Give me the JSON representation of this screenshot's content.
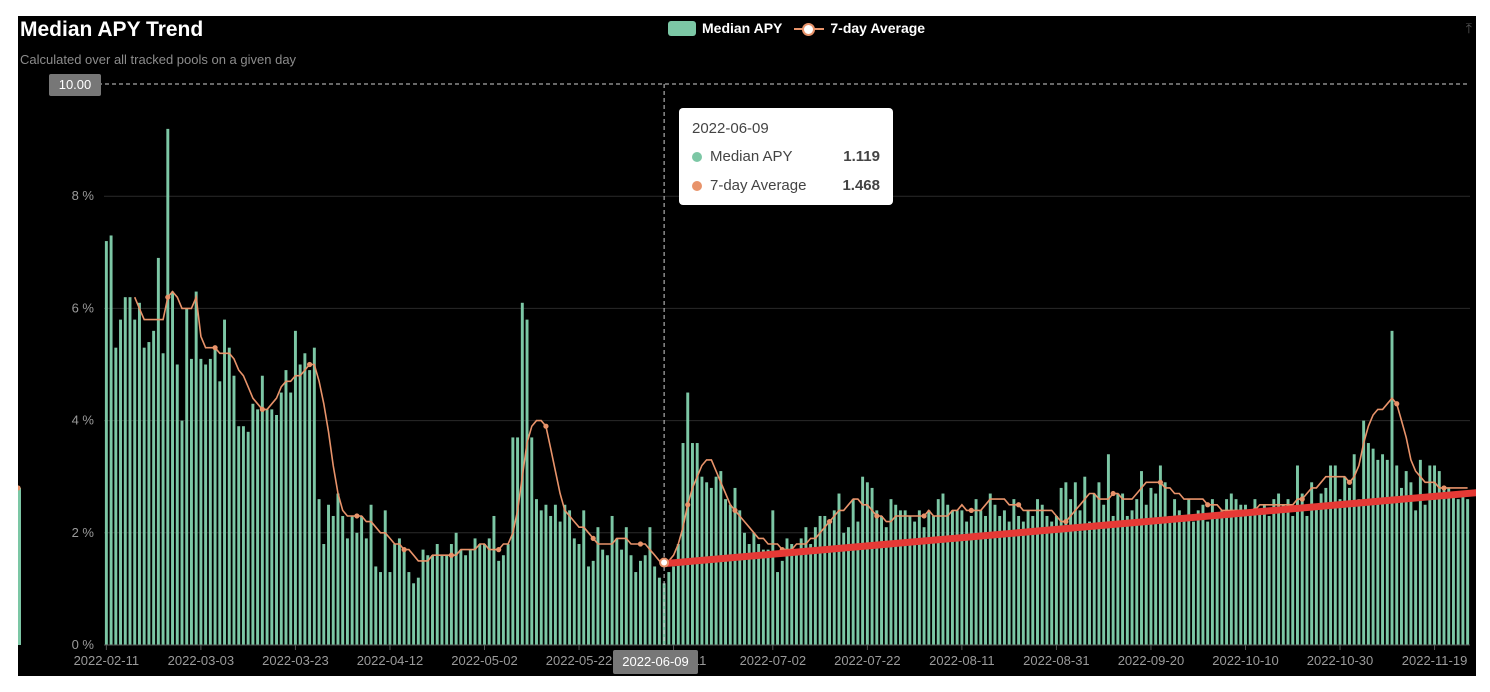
{
  "header": {
    "title": "Median APY Trend",
    "subtitle": "Calculated over all tracked pools on a given day"
  },
  "legend": {
    "bar_label": "Median APY",
    "line_label": "7-day Average"
  },
  "tooltip": {
    "date": "2022-06-09",
    "rows": [
      {
        "name": "Median APY",
        "value": "1.119",
        "color": "#7cc7a5"
      },
      {
        "name": "7-day Average",
        "value": "1.468",
        "color": "#e8936a"
      }
    ]
  },
  "reference_line": {
    "label": "10.00",
    "value": 10
  },
  "crosshair": {
    "label": "2022-06-09"
  },
  "colors": {
    "bar": "#7cc7a5",
    "line": "#e8936a",
    "trend": "#e53935",
    "background": "#000000"
  },
  "chart_data": {
    "type": "bar",
    "ylim": [
      0,
      10
    ],
    "y_ticks": [
      0,
      2,
      4,
      6,
      8
    ],
    "y_tick_labels": [
      "0 %",
      "2 %",
      "4 %",
      "6 %",
      "8 %"
    ],
    "x_tick_labels": [
      "2022-02-11",
      "2022-03-03",
      "2022-03-23",
      "2022-04-12",
      "2022-05-02",
      "2022-05-22",
      "2022-06-11",
      "2022-07-02",
      "2022-07-22",
      "2022-08-11",
      "2022-08-31",
      "2022-09-20",
      "2022-10-10",
      "2022-10-30",
      "2022-11-19"
    ],
    "x_tick_dates": [
      "2022-02-11",
      "2022-03-03",
      "2022-03-23",
      "2022-04-12",
      "2022-05-02",
      "2022-05-22",
      "2022-06-11",
      "2022-07-02",
      "2022-07-22",
      "2022-08-11",
      "2022-08-31",
      "2022-09-20",
      "2022-10-10",
      "2022-10-30",
      "2022-11-19"
    ],
    "dates": [
      "2022-02-11",
      "2022-02-12",
      "2022-02-13",
      "2022-02-14",
      "2022-02-15",
      "2022-02-16",
      "2022-02-17",
      "2022-02-18",
      "2022-02-19",
      "2022-02-20",
      "2022-02-21",
      "2022-02-22",
      "2022-02-23",
      "2022-02-24",
      "2022-02-25",
      "2022-02-26",
      "2022-02-27",
      "2022-02-28",
      "2022-03-01",
      "2022-03-02",
      "2022-03-03",
      "2022-03-04",
      "2022-03-05",
      "2022-03-06",
      "2022-03-07",
      "2022-03-08",
      "2022-03-09",
      "2022-03-10",
      "2022-03-11",
      "2022-03-12",
      "2022-03-13",
      "2022-03-14",
      "2022-03-15",
      "2022-03-16",
      "2022-03-17",
      "2022-03-18",
      "2022-03-19",
      "2022-03-20",
      "2022-03-21",
      "2022-03-22",
      "2022-03-23",
      "2022-03-24",
      "2022-03-25",
      "2022-03-26",
      "2022-03-27",
      "2022-03-28",
      "2022-03-29",
      "2022-03-30",
      "2022-03-31",
      "2022-04-01",
      "2022-04-02",
      "2022-04-03",
      "2022-04-04",
      "2022-04-05",
      "2022-04-06",
      "2022-04-07",
      "2022-04-08",
      "2022-04-09",
      "2022-04-10",
      "2022-04-11",
      "2022-04-12",
      "2022-04-13",
      "2022-04-14",
      "2022-04-15",
      "2022-04-16",
      "2022-04-17",
      "2022-04-18",
      "2022-04-19",
      "2022-04-20",
      "2022-04-21",
      "2022-04-22",
      "2022-04-23",
      "2022-04-24",
      "2022-04-25",
      "2022-04-26",
      "2022-04-27",
      "2022-04-28",
      "2022-04-29",
      "2022-04-30",
      "2022-05-01",
      "2022-05-02",
      "2022-05-03",
      "2022-05-04",
      "2022-05-05",
      "2022-05-06",
      "2022-05-07",
      "2022-05-08",
      "2022-05-09",
      "2022-05-10",
      "2022-05-11",
      "2022-05-12",
      "2022-05-13",
      "2022-05-14",
      "2022-05-15",
      "2022-05-16",
      "2022-05-17",
      "2022-05-18",
      "2022-05-19",
      "2022-05-20",
      "2022-05-21",
      "2022-05-22",
      "2022-05-23",
      "2022-05-24",
      "2022-05-25",
      "2022-05-26",
      "2022-05-27",
      "2022-05-28",
      "2022-05-29",
      "2022-05-30",
      "2022-05-31",
      "2022-06-01",
      "2022-06-02",
      "2022-06-03",
      "2022-06-04",
      "2022-06-05",
      "2022-06-06",
      "2022-06-07",
      "2022-06-08",
      "2022-06-09",
      "2022-06-10",
      "2022-06-11",
      "2022-06-12",
      "2022-06-13",
      "2022-06-14",
      "2022-06-15",
      "2022-06-16",
      "2022-06-17",
      "2022-06-18",
      "2022-06-19",
      "2022-06-20",
      "2022-06-21",
      "2022-06-22",
      "2022-06-23",
      "2022-06-24",
      "2022-06-25",
      "2022-06-26",
      "2022-06-27",
      "2022-06-28",
      "2022-06-29",
      "2022-06-30",
      "2022-07-01",
      "2022-07-02",
      "2022-07-03",
      "2022-07-04",
      "2022-07-05",
      "2022-07-06",
      "2022-07-07",
      "2022-07-08",
      "2022-07-09",
      "2022-07-10",
      "2022-07-11",
      "2022-07-12",
      "2022-07-13",
      "2022-07-14",
      "2022-07-15",
      "2022-07-16",
      "2022-07-17",
      "2022-07-18",
      "2022-07-19",
      "2022-07-20",
      "2022-07-21",
      "2022-07-22",
      "2022-07-23",
      "2022-07-24",
      "2022-07-25",
      "2022-07-26",
      "2022-07-27",
      "2022-07-28",
      "2022-07-29",
      "2022-07-30",
      "2022-07-31",
      "2022-08-01",
      "2022-08-02",
      "2022-08-03",
      "2022-08-04",
      "2022-08-05",
      "2022-08-06",
      "2022-08-07",
      "2022-08-08",
      "2022-08-09",
      "2022-08-10",
      "2022-08-11",
      "2022-08-12",
      "2022-08-13",
      "2022-08-14",
      "2022-08-15",
      "2022-08-16",
      "2022-08-17",
      "2022-08-18",
      "2022-08-19",
      "2022-08-20",
      "2022-08-21",
      "2022-08-22",
      "2022-08-23",
      "2022-08-24",
      "2022-08-25",
      "2022-08-26",
      "2022-08-27",
      "2022-08-28",
      "2022-08-29",
      "2022-08-30",
      "2022-08-31",
      "2022-09-01",
      "2022-09-02",
      "2022-09-03",
      "2022-09-04",
      "2022-09-05",
      "2022-09-06",
      "2022-09-07",
      "2022-09-08",
      "2022-09-09",
      "2022-09-10",
      "2022-09-11",
      "2022-09-12",
      "2022-09-13",
      "2022-09-14",
      "2022-09-15",
      "2022-09-16",
      "2022-09-17",
      "2022-09-18",
      "2022-09-19",
      "2022-09-20",
      "2022-09-21",
      "2022-09-22",
      "2022-09-23",
      "2022-09-24",
      "2022-09-25",
      "2022-09-26",
      "2022-09-27",
      "2022-09-28",
      "2022-09-29",
      "2022-09-30",
      "2022-10-01",
      "2022-10-02",
      "2022-10-03",
      "2022-10-04",
      "2022-10-05",
      "2022-10-06",
      "2022-10-07",
      "2022-10-08",
      "2022-10-09",
      "2022-10-10",
      "2022-10-11",
      "2022-10-12",
      "2022-10-13",
      "2022-10-14",
      "2022-10-15",
      "2022-10-16",
      "2022-10-17",
      "2022-10-18",
      "2022-10-19",
      "2022-10-20",
      "2022-10-21",
      "2022-10-22",
      "2022-10-23",
      "2022-10-24",
      "2022-10-25",
      "2022-10-26",
      "2022-10-27",
      "2022-10-28",
      "2022-10-29",
      "2022-10-30",
      "2022-10-31",
      "2022-11-01",
      "2022-11-02",
      "2022-11-03",
      "2022-11-04",
      "2022-11-05",
      "2022-11-06",
      "2022-11-07",
      "2022-11-08",
      "2022-11-09",
      "2022-11-10",
      "2022-11-11",
      "2022-11-12",
      "2022-11-13",
      "2022-11-14",
      "2022-11-15",
      "2022-11-16",
      "2022-11-17",
      "2022-11-18",
      "2022-11-19",
      "2022-11-20",
      "2022-11-21",
      "2022-11-22",
      "2022-11-23",
      "2022-11-24",
      "2022-11-25",
      "2022-11-26"
    ],
    "series": [
      {
        "name": "Median APY",
        "type": "bar",
        "values": [
          7.2,
          7.3,
          5.3,
          5.8,
          6.2,
          6.2,
          5.8,
          6.1,
          5.3,
          5.4,
          5.6,
          6.9,
          5.2,
          9.2,
          6.3,
          5.0,
          4.0,
          6.0,
          5.1,
          6.3,
          5.1,
          5.0,
          5.1,
          5.3,
          4.7,
          5.8,
          5.3,
          4.8,
          3.9,
          3.9,
          3.8,
          4.3,
          4.2,
          4.8,
          4.2,
          4.2,
          4.1,
          4.5,
          4.9,
          4.5,
          5.6,
          5.0,
          5.2,
          4.9,
          5.3,
          2.6,
          1.8,
          2.5,
          2.3,
          2.7,
          2.3,
          1.9,
          2.3,
          2.0,
          2.3,
          1.9,
          2.5,
          1.4,
          1.3,
          2.4,
          1.3,
          1.8,
          1.9,
          1.7,
          1.3,
          1.1,
          1.2,
          1.7,
          1.6,
          1.6,
          1.8,
          1.6,
          1.6,
          1.8,
          2.0,
          1.7,
          1.6,
          1.7,
          1.9,
          1.8,
          1.8,
          1.9,
          2.3,
          1.5,
          1.6,
          1.8,
          3.7,
          3.7,
          6.1,
          5.8,
          3.7,
          2.6,
          2.4,
          2.5,
          2.3,
          2.5,
          2.2,
          2.5,
          2.4,
          1.9,
          1.8,
          2.4,
          1.4,
          1.5,
          2.1,
          1.7,
          1.6,
          2.3,
          1.9,
          1.7,
          2.1,
          1.6,
          1.3,
          1.5,
          1.6,
          2.1,
          1.4,
          1.2,
          1.1,
          1.3,
          1.4,
          1.8,
          3.6,
          4.5,
          3.6,
          3.6,
          3.0,
          2.9,
          2.8,
          3.0,
          3.1,
          2.6,
          2.5,
          2.8,
          2.4,
          2.0,
          1.8,
          2.0,
          1.8,
          1.7,
          1.7,
          2.4,
          1.3,
          1.5,
          1.9,
          1.8,
          1.7,
          1.9,
          2.1,
          1.8,
          2.1,
          2.3,
          2.3,
          2.2,
          2.4,
          2.7,
          2.0,
          2.1,
          2.6,
          2.2,
          3.0,
          2.9,
          2.8,
          2.4,
          2.3,
          2.1,
          2.6,
          2.5,
          2.4,
          2.4,
          2.3,
          2.2,
          2.4,
          2.1,
          2.4,
          2.3,
          2.6,
          2.7,
          2.5,
          2.4,
          2.4,
          2.4,
          2.2,
          2.3,
          2.6,
          2.4,
          2.3,
          2.7,
          2.5,
          2.3,
          2.4,
          2.2,
          2.6,
          2.3,
          2.2,
          2.4,
          2.3,
          2.6,
          2.5,
          2.3,
          2.2,
          2.3,
          2.8,
          2.9,
          2.6,
          2.9,
          2.4,
          3.0,
          2.2,
          2.7,
          2.9,
          2.5,
          3.4,
          2.3,
          2.7,
          2.7,
          2.3,
          2.4,
          2.6,
          3.1,
          2.5,
          2.8,
          2.7,
          3.2,
          2.9,
          2.3,
          2.6,
          2.4,
          2.3,
          2.6,
          2.2,
          2.4,
          2.5,
          2.2,
          2.6,
          2.3,
          2.4,
          2.6,
          2.7,
          2.6,
          2.5,
          2.5,
          2.4,
          2.6,
          2.4,
          2.5,
          2.3,
          2.6,
          2.7,
          2.5,
          2.6,
          2.3,
          3.2,
          2.7,
          2.3,
          2.9,
          2.5,
          2.7,
          2.8,
          3.2,
          3.2,
          2.6,
          3.0,
          2.8,
          3.4,
          2.6,
          4.0,
          3.6,
          3.5,
          3.3,
          3.4,
          3.3,
          5.6,
          3.2,
          2.8,
          3.1,
          2.9,
          2.4,
          3.3,
          2.5,
          3.2,
          3.2,
          3.1,
          2.8,
          2.8,
          2.7,
          2.6,
          2.7,
          2.6,
          2.8,
          2.7,
          2.6,
          2.7,
          2.8,
          2.3,
          2.7
        ]
      },
      {
        "name": "7-day Average",
        "type": "line",
        "values": [
          null,
          null,
          null,
          null,
          null,
          null,
          6.2,
          6.0,
          5.8,
          5.8,
          5.8,
          5.8,
          5.8,
          6.2,
          6.3,
          6.2,
          6.0,
          6.0,
          6.0,
          6.2,
          5.5,
          5.3,
          5.3,
          5.3,
          5.2,
          5.2,
          5.2,
          5.1,
          4.9,
          4.8,
          4.6,
          4.4,
          4.3,
          4.2,
          4.2,
          4.3,
          4.4,
          4.6,
          4.7,
          4.7,
          4.8,
          4.8,
          4.9,
          5.0,
          5.0,
          4.7,
          4.3,
          3.8,
          3.2,
          2.7,
          2.4,
          2.3,
          2.3,
          2.3,
          2.3,
          2.2,
          2.2,
          2.1,
          2.0,
          2.0,
          1.9,
          1.8,
          1.8,
          1.7,
          1.7,
          1.6,
          1.5,
          1.5,
          1.5,
          1.6,
          1.6,
          1.6,
          1.6,
          1.6,
          1.6,
          1.7,
          1.7,
          1.7,
          1.7,
          1.8,
          1.8,
          1.7,
          1.7,
          1.7,
          1.8,
          1.8,
          2.0,
          2.4,
          3.0,
          3.6,
          3.9,
          4.0,
          4.0,
          3.9,
          3.5,
          3.1,
          2.7,
          2.4,
          2.3,
          2.2,
          2.1,
          2.1,
          2.0,
          1.9,
          1.8,
          1.8,
          1.8,
          1.8,
          1.9,
          1.9,
          1.9,
          1.8,
          1.8,
          1.8,
          1.8,
          1.7,
          1.6,
          1.5,
          1.47,
          1.5,
          1.6,
          1.8,
          2.1,
          2.5,
          2.8,
          3.0,
          3.2,
          3.3,
          3.3,
          3.1,
          2.9,
          2.7,
          2.5,
          2.4,
          2.3,
          2.2,
          2.1,
          2.0,
          1.9,
          1.9,
          1.8,
          1.8,
          1.8,
          1.7,
          1.7,
          1.7,
          1.8,
          1.8,
          1.8,
          1.9,
          1.9,
          2.0,
          2.1,
          2.2,
          2.3,
          2.4,
          2.4,
          2.5,
          2.6,
          2.6,
          2.5,
          2.5,
          2.4,
          2.3,
          2.3,
          2.2,
          2.2,
          2.3,
          2.3,
          2.3,
          2.3,
          2.3,
          2.3,
          2.3,
          2.4,
          2.3,
          2.3,
          2.3,
          2.3,
          2.4,
          2.4,
          2.5,
          2.4,
          2.4,
          2.4,
          2.4,
          2.5,
          2.6,
          2.6,
          2.6,
          2.6,
          2.5,
          2.5,
          2.5,
          2.4,
          2.4,
          2.4,
          2.4,
          2.4,
          2.4,
          2.4,
          2.3,
          2.2,
          2.2,
          2.3,
          2.4,
          2.5,
          2.6,
          2.7,
          2.7,
          2.6,
          2.6,
          2.6,
          2.7,
          2.7,
          2.6,
          2.6,
          2.6,
          2.7,
          2.8,
          2.9,
          2.9,
          2.9,
          2.9,
          2.8,
          2.8,
          2.7,
          2.7,
          2.6,
          2.6,
          2.6,
          2.6,
          2.6,
          2.5,
          2.5,
          2.5,
          2.4,
          2.4,
          2.4,
          2.4,
          2.4,
          2.4,
          2.4,
          2.4,
          2.5,
          2.5,
          2.5,
          2.5,
          2.5,
          2.5,
          2.5,
          2.5,
          2.6,
          2.6,
          2.7,
          2.8,
          2.8,
          2.9,
          3.0,
          3.0,
          3.0,
          3.0,
          3.0,
          2.9,
          3.0,
          3.2,
          3.6,
          3.9,
          4.1,
          4.2,
          4.2,
          4.3,
          4.4,
          4.3,
          4.0,
          3.7,
          3.3,
          3.1,
          3.0,
          2.9,
          2.9,
          2.9,
          2.8,
          2.8,
          2.8,
          2.8,
          2.8,
          2.8,
          2.8,
          2.8,
          2.8,
          2.8,
          2.8,
          2.8,
          2.8,
          2.8
        ]
      }
    ],
    "trend_line": {
      "start": [
        "2022-06-09",
        1.45
      ],
      "end": [
        "2022-11-26",
        2.72
      ]
    },
    "crosshair_date": "2022-06-09",
    "grid": true,
    "legend_position": "top"
  }
}
